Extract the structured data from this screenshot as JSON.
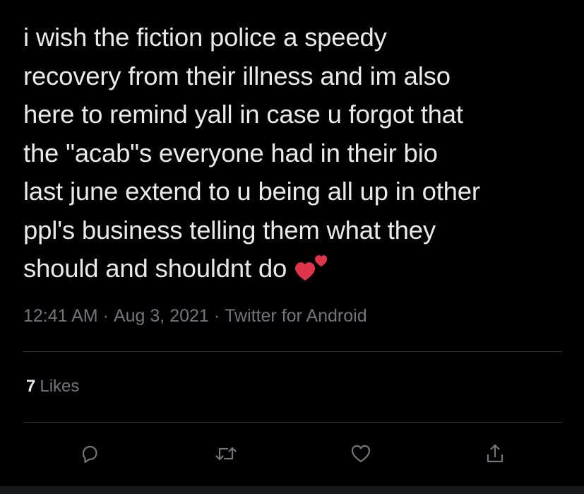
{
  "tweet": {
    "text_lines": [
      "i wish the fiction police a speedy",
      "recovery from their illness and im also",
      "here to remind yall in case u forgot that",
      "the \"acab\"s everyone had in their bio",
      "last june extend to u being all up in other",
      "ppl's business telling them what they",
      "should and shouldnt do"
    ],
    "emoji": "two-hearts-emoji",
    "time": "12:41 AM",
    "date": "Aug 3, 2021",
    "source": "Twitter for Android",
    "separator": "·"
  },
  "engagement": {
    "likes_count": "7",
    "likes_label": "Likes"
  },
  "actions": {
    "reply_icon": "reply-icon",
    "retweet_icon": "retweet-icon",
    "like_icon": "heart-icon",
    "share_icon": "share-icon"
  },
  "colors": {
    "background": "#000000",
    "text": "#e7e9ea",
    "secondary_text": "#71767b",
    "divider": "#2f3336",
    "emoji_red": "#e0344b"
  }
}
